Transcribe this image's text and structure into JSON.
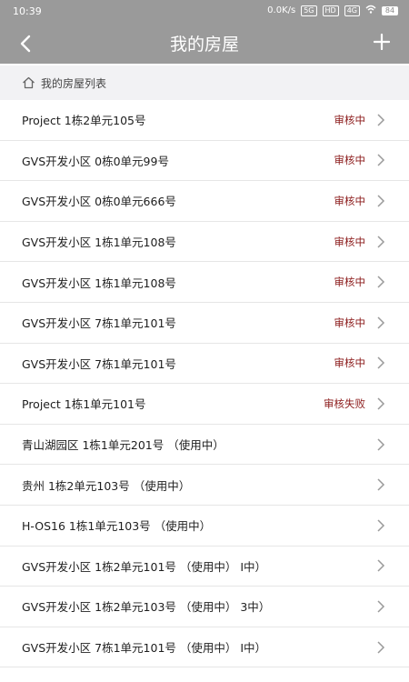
{
  "status_bar": {
    "time": "10:39",
    "speed": "0.0K/s",
    "signal_label": "5G",
    "hd_label": "HD",
    "net_label": "4G",
    "battery": "84"
  },
  "header": {
    "title": "我的房屋",
    "back_icon": "back-arrow-icon",
    "add_icon": "plus-icon"
  },
  "breadcrumb": {
    "icon": "home-icon",
    "label": "我的房屋列表"
  },
  "houses": [
    {
      "label": "Project 1栋2单元105号",
      "status": "审核中"
    },
    {
      "label": "GVS开发小区 0栋0单元99号",
      "status": "审核中"
    },
    {
      "label": "GVS开发小区 0栋0单元666号",
      "status": "审核中"
    },
    {
      "label": "GVS开发小区 1栋1单元108号",
      "status": "审核中"
    },
    {
      "label": "GVS开发小区 1栋1单元108号",
      "status": "审核中"
    },
    {
      "label": "GVS开发小区 7栋1单元101号",
      "status": "审核中"
    },
    {
      "label": "GVS开发小区 7栋1单元101号",
      "status": "审核中"
    },
    {
      "label": "Project 1栋1单元101号",
      "status": "审核失败"
    },
    {
      "label": "青山湖园区 1栋1单元201号 （使用中）",
      "status": ""
    },
    {
      "label": "贵州 1栋2单元103号 （使用中）",
      "status": ""
    },
    {
      "label": "H-OS16 1栋1单元103号 （使用中）",
      "status": ""
    },
    {
      "label": "GVS开发小区 1栋2单元101号 （使用中） I中）",
      "status": ""
    },
    {
      "label": "GVS开发小区 1栋2单元103号 （使用中） 3中）",
      "status": ""
    },
    {
      "label": "GVS开发小区 7栋1单元101号 （使用中） I中）",
      "status": ""
    }
  ],
  "colors": {
    "topbar": "#9a9a9a",
    "status_pending": "#8b1a1a",
    "breadcrumb_bg": "#f2f2f4"
  }
}
